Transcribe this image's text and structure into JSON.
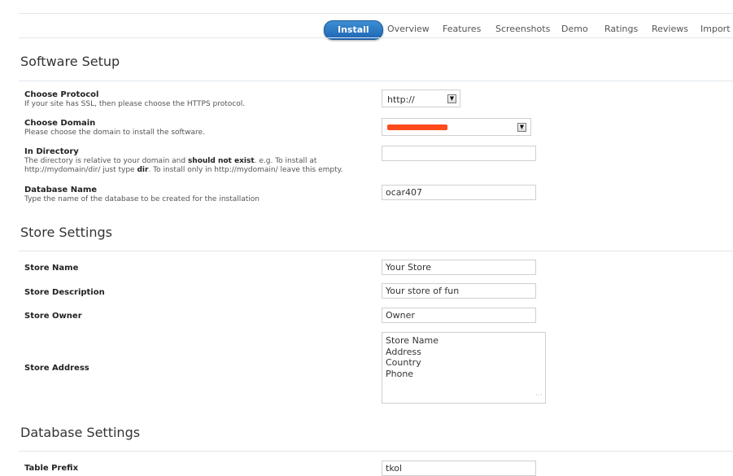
{
  "tabs": [
    {
      "label": "Install",
      "active": true
    },
    {
      "label": "Overview"
    },
    {
      "label": "Features"
    },
    {
      "label": "Screenshots"
    },
    {
      "label": "Demo"
    },
    {
      "label": "Ratings"
    },
    {
      "label": "Reviews"
    },
    {
      "label": "Import"
    }
  ],
  "software_setup": {
    "title": "Software Setup",
    "protocol": {
      "label": "Choose Protocol",
      "desc": "If your site has SSL, then please choose the HTTPS protocol.",
      "value": "http://"
    },
    "domain": {
      "label": "Choose Domain",
      "desc": "Please choose the domain to install the software.",
      "value": ""
    },
    "directory": {
      "label": "In Directory",
      "desc_1": "The directory is relative to your domain and ",
      "desc_bold_1": "should not exist",
      "desc_2": ". e.g. To install at",
      "desc_3": "http://mydomain/dir/ just type ",
      "desc_bold_2": "dir",
      "desc_4": ". To install only in http://mydomain/ leave this empty.",
      "value": ""
    },
    "database": {
      "label": "Database Name",
      "desc": "Type the name of the database to be created for the installation",
      "value": "ocar407"
    }
  },
  "store_settings": {
    "title": "Store Settings",
    "name": {
      "label": "Store Name",
      "value": "Your Store"
    },
    "description": {
      "label": "Store Description",
      "value": "Your store of fun"
    },
    "owner": {
      "label": "Store Owner",
      "value": "Owner"
    },
    "address": {
      "label": "Store Address",
      "value": "Store Name\nAddress\nCountry\nPhone"
    }
  },
  "database_settings": {
    "title": "Database Settings",
    "prefix": {
      "label": "Table Prefix",
      "value": "tkol"
    }
  },
  "colors": {
    "accent": "#2a78c4",
    "redaction": "#ff4a1c"
  }
}
